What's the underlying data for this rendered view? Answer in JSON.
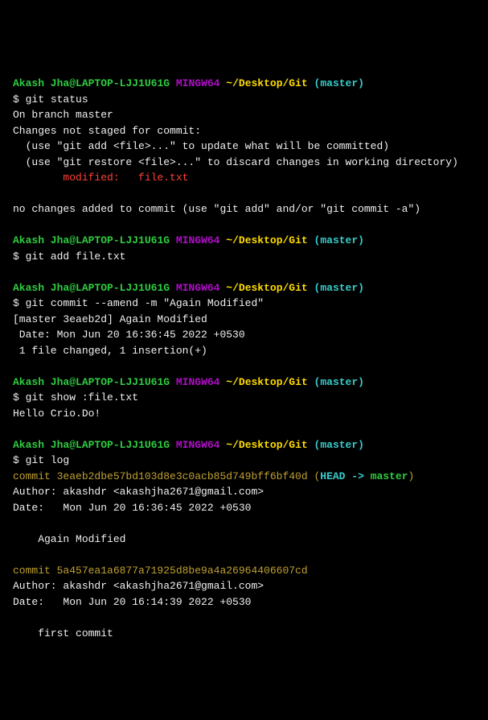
{
  "prompt": {
    "user": "Akash Jha",
    "at": "@",
    "host": "LAPTOP-LJJ1U61G",
    "shell": "MINGW64",
    "path": "~/Desktop/Git",
    "branch_open": "(",
    "branch": "master",
    "branch_close": ")",
    "sigil": "$ "
  },
  "s1": {
    "cmd": "git status",
    "l1": "On branch master",
    "l2": "Changes not staged for commit:",
    "l3": "  (use \"git add <file>...\" to update what will be committed)",
    "l4": "  (use \"git restore <file>...\" to discard changes in working directory)",
    "l5": "        modified:   file.txt",
    "l6": "no changes added to commit (use \"git add\" and/or \"git commit -a\")"
  },
  "s2": {
    "cmd": "git add file.txt"
  },
  "s3": {
    "cmd": "git commit --amend -m \"Again Modified\"",
    "l1": "[master 3eaeb2d] Again Modified",
    "l2": " Date: Mon Jun 20 16:36:45 2022 +0530",
    "l3": " 1 file changed, 1 insertion(+)"
  },
  "s4": {
    "cmd": "git show :file.txt",
    "l1": "Hello Crio.Do!"
  },
  "s5": {
    "cmd": "git log",
    "c1_prefix": "commit ",
    "c1_hash": "3eaeb2dbe57bd103d8e3c0acb85d749bff6bf40d",
    "c1_headopen": " (",
    "c1_head": "HEAD -> ",
    "c1_branch": "master",
    "c1_headclose": ")",
    "c1_author": "Author: akashdr <akashjha2671@gmail.com>",
    "c1_date": "Date:   Mon Jun 20 16:36:45 2022 +0530",
    "c1_msg": "    Again Modified",
    "c2_line": "commit 5a457ea1a6877a71925d8be9a4a26964406607cd",
    "c2_author": "Author: akashdr <akashjha2671@gmail.com>",
    "c2_date": "Date:   Mon Jun 20 16:14:39 2022 +0530",
    "c2_msg": "    first commit"
  }
}
